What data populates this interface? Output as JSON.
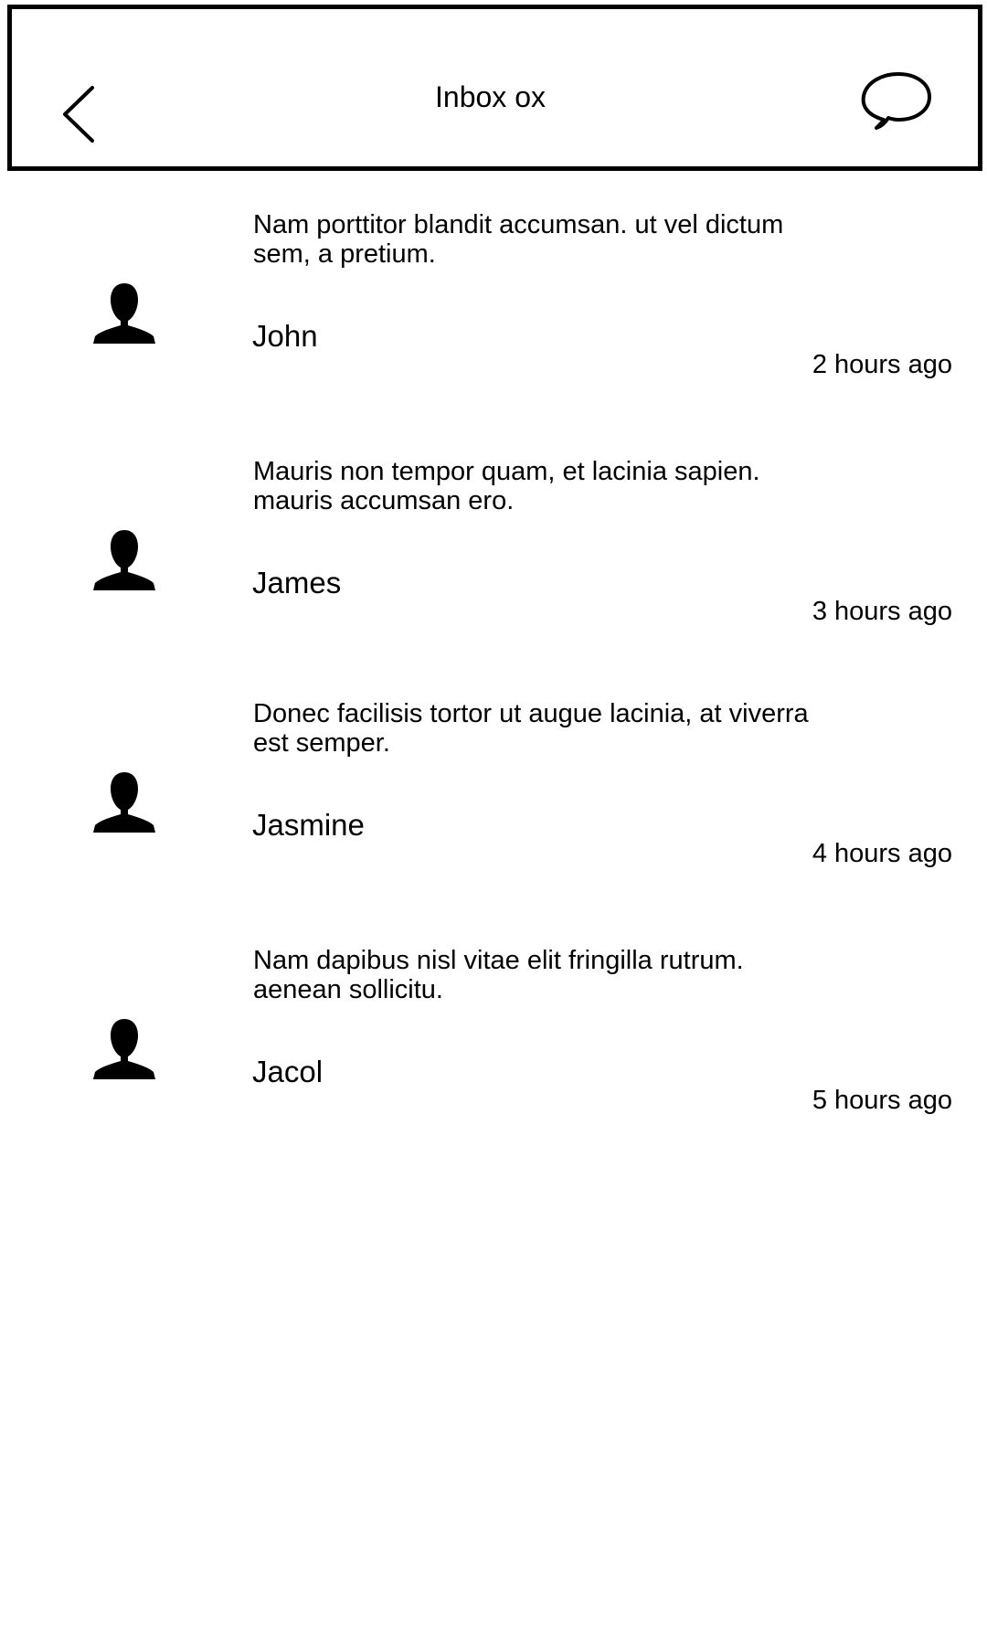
{
  "header": {
    "title": "Inbox ox",
    "back_icon": "chevron-left-icon",
    "compose_icon": "speech-bubble-icon"
  },
  "messages": [
    {
      "preview": "Nam porttitor blandit accumsan. ut vel dictum sem, a pretium.",
      "sender": "John",
      "time": "2 hours ago",
      "avatar_icon": "user-silhouette-icon"
    },
    {
      "preview": "Mauris non tempor quam, et lacinia sapien. mauris accumsan ero.",
      "sender": "James",
      "time": "3 hours ago",
      "avatar_icon": "user-silhouette-icon"
    },
    {
      "preview": "Donec facilisis tortor ut augue lacinia, at viverra est semper.",
      "sender": "Jasmine",
      "time": "4 hours ago",
      "avatar_icon": "user-silhouette-icon"
    },
    {
      "preview": "Nam dapibus nisl vitae elit fringilla rutrum. aenean sollicitu.",
      "sender": "Jacol",
      "time": "5 hours ago",
      "avatar_icon": "user-silhouette-icon"
    }
  ]
}
